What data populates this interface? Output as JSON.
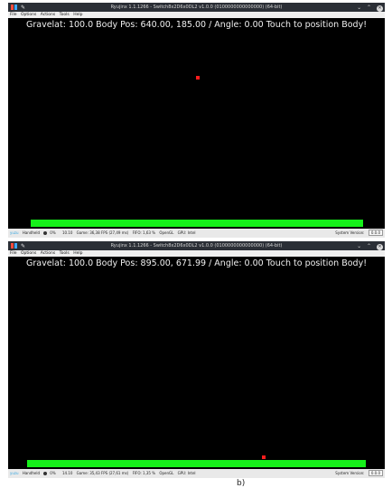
{
  "windows": [
    {
      "title": "Ryujinx 1.1.1266 - Switch8x2D6x0DL2 v1.0.0 (0100000000000000) (64-bit)",
      "menu": [
        "File",
        "Options",
        "Actions",
        "Tools",
        "Help"
      ],
      "hud_text": "Gravelat: 100.0 Body Pos: 640.00, 185.00 / Angle: 0.00 Touch to position Body!",
      "status": {
        "brand": "yuzu",
        "dock": "Handheld",
        "volume": "0%",
        "fps": "10.10",
        "game": "Game: 36,38 FPS (27,49 ms)",
        "fifo": "FIFO: 1,63 %",
        "api": "OpenGL",
        "gpu": "GPU: Intel",
        "system_version_label": "System Version:",
        "system_version_value": "0.0.0"
      }
    },
    {
      "title": "Ryujinx 1.1.1266 - Switch8x2D6x0DL2 v1.0.0 (0100000000000000) (64-bit)",
      "menu": [
        "File",
        "Options",
        "Actions",
        "Tools",
        "Help"
      ],
      "hud_text": "Gravelat: 100.0 Body Pos: 895.00, 671.99 / Angle: 0.00 Touch to position Body!",
      "status": {
        "brand": "yuzu",
        "dock": "Handheld",
        "volume": "0%",
        "fps": "14.10",
        "game": "Game: 35,43 FPS (27,61 ms)",
        "fifo": "FIFO: 1,35 %",
        "api": "OpenGL",
        "gpu": "GPU: Intel",
        "system_version_label": "System Version:",
        "system_version_value": "0.0.0"
      }
    }
  ],
  "caption": "b)",
  "colors": {
    "ground": "#16f01a",
    "body": "#ff1c1c",
    "titlebar": "#2b2f36"
  }
}
